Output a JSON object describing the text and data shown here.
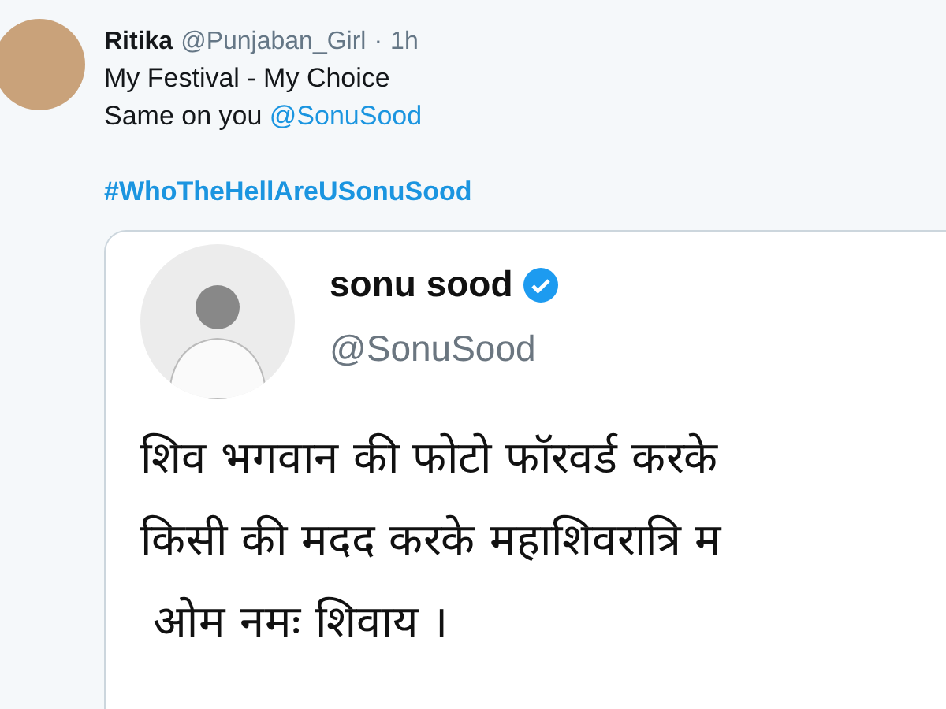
{
  "tweet": {
    "author_name": "Ritika",
    "author_handle": "@Punjaban_Girl",
    "separator": "·",
    "time": "1h",
    "lines": [
      {
        "kind": "plain",
        "text": "My Festival - My Choice"
      },
      {
        "kind": "mention",
        "text": "Same on you",
        "mention": "@SonuSood"
      },
      {
        "kind": "hashtag",
        "text": "#WhoTheHellAreUSonuSood"
      }
    ],
    "quoted": {
      "author_name": "sonu sood",
      "verified": true,
      "author_handle": "@SonuSood",
      "lines": [
        "शिव भगवान की फोटो फॉरवर्ड करके",
        "किसी की मदद करके महाशिवरात्रि म",
        "ओम नमः शिवाय ।"
      ]
    }
  }
}
